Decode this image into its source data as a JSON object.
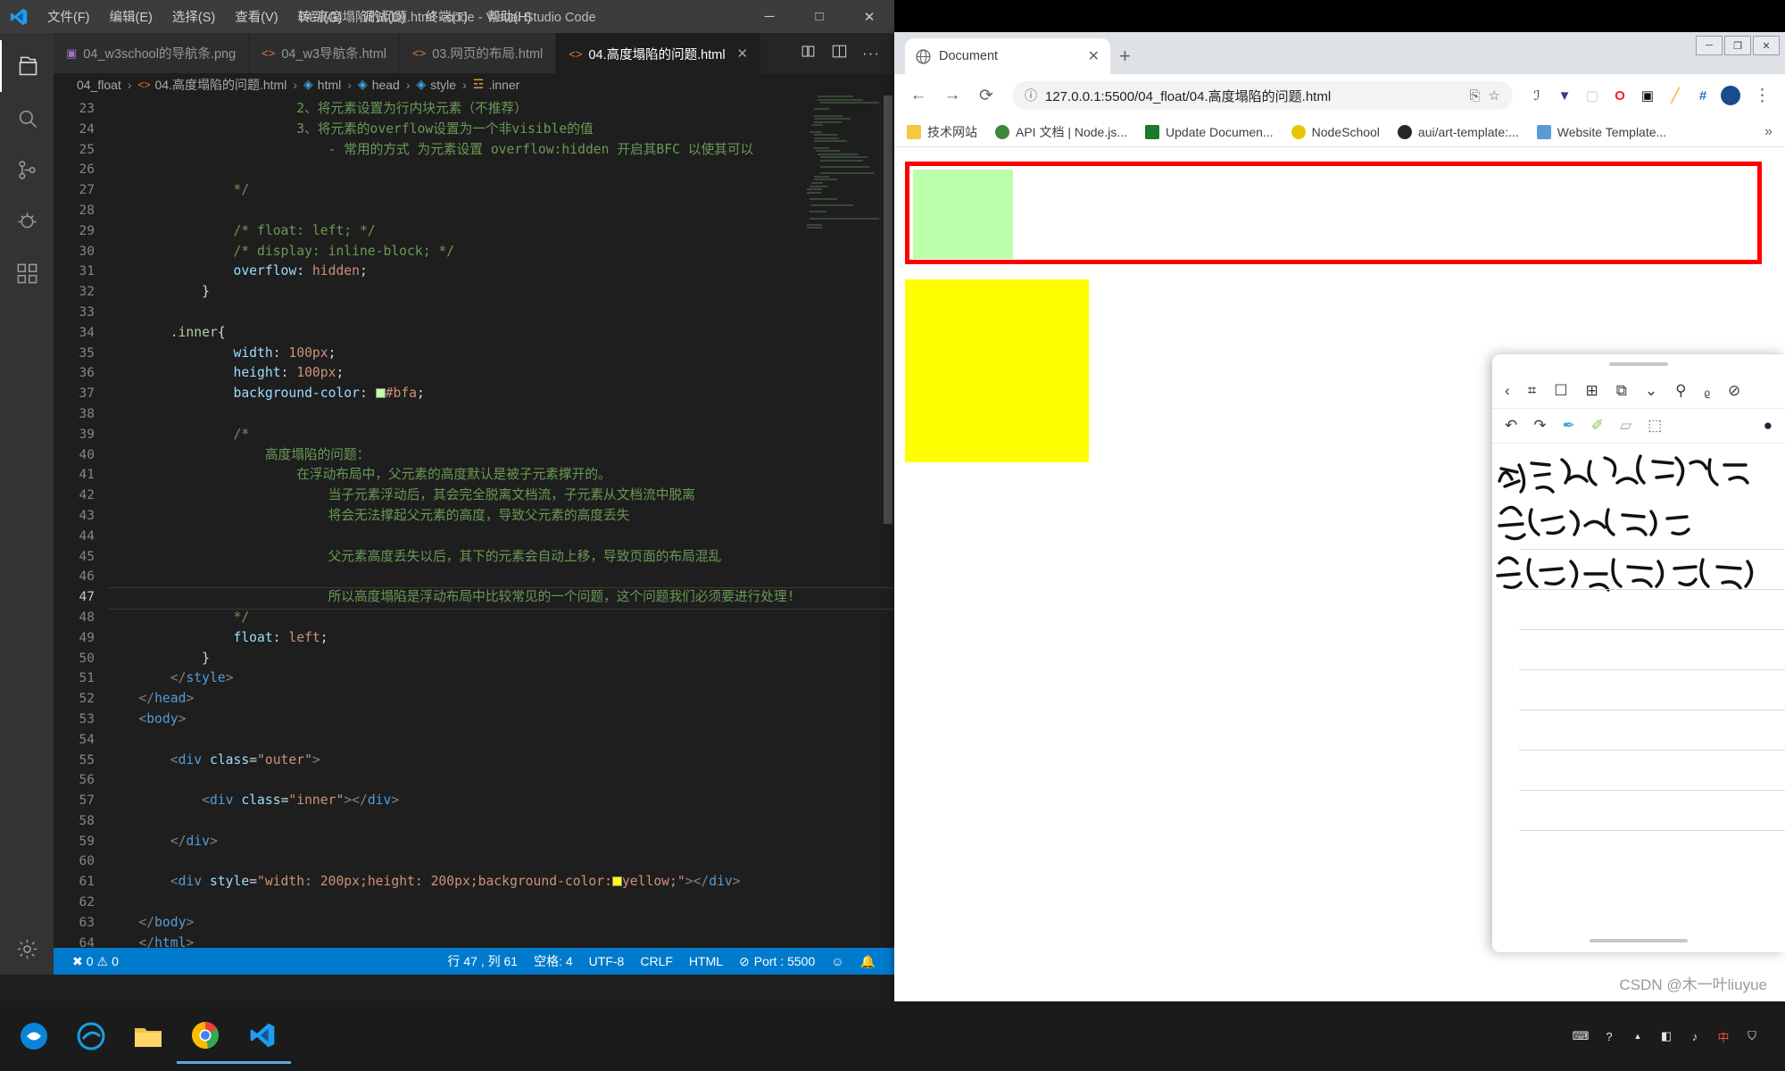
{
  "vscode": {
    "window_title": "04.高度塌陷的问题.html - code - Visual Studio Code",
    "logo_icon": "vscode-logo-icon",
    "menu": [
      {
        "label": "文件(F)",
        "name": "menu-file"
      },
      {
        "label": "编辑(E)",
        "name": "menu-edit"
      },
      {
        "label": "选择(S)",
        "name": "menu-selection"
      },
      {
        "label": "查看(V)",
        "name": "menu-view"
      },
      {
        "label": "转到(G)",
        "name": "menu-go"
      },
      {
        "label": "调试(D)",
        "name": "menu-debug"
      },
      {
        "label": "终端(T)",
        "name": "menu-terminal"
      },
      {
        "label": "帮助(H)",
        "name": "menu-help"
      }
    ],
    "window_buttons": {
      "minimize": "─",
      "maximize": "□",
      "close": "✕"
    },
    "activity_bar": [
      {
        "name": "explorer-icon",
        "label": "Explorer"
      },
      {
        "name": "search-icon",
        "label": "Search"
      },
      {
        "name": "source-control-icon",
        "label": "Source Control"
      },
      {
        "name": "debug-icon",
        "label": "Run and Debug"
      },
      {
        "name": "extensions-icon",
        "label": "Extensions"
      },
      {
        "name": "settings-gear-icon",
        "label": "Manage"
      }
    ],
    "tabs": [
      {
        "label": "04_w3school的导航条.png",
        "icon": "image-file-icon",
        "active": false
      },
      {
        "label": "04_w3导航条.html",
        "icon": "html-file-icon",
        "active": false
      },
      {
        "label": "03.网页的布局.html",
        "icon": "html-file-icon",
        "active": false
      },
      {
        "label": "04.高度塌陷的问题.html",
        "icon": "html-file-icon",
        "active": true,
        "close": "✕"
      }
    ],
    "tab_actions": [
      {
        "name": "split-editor-icon"
      },
      {
        "name": "open-changes-icon"
      },
      {
        "name": "more-actions-icon",
        "label": "···"
      }
    ],
    "breadcrumb": [
      {
        "label": "04_float",
        "icon": "folder-icon"
      },
      {
        "label": "04.高度塌陷的问题.html",
        "icon": "html-file-icon"
      },
      {
        "label": "html",
        "icon": "symbol-cube-icon"
      },
      {
        "label": "head",
        "icon": "symbol-cube-icon"
      },
      {
        "label": "style",
        "icon": "symbol-cube-icon"
      },
      {
        "label": ".inner",
        "icon": "symbol-ruler-icon"
      }
    ],
    "breadcrumb_separator": "›",
    "first_line_number": 23,
    "current_line": 47,
    "code_lines": [
      {
        "n": 23,
        "html": "                        <span class=\"cm\">2、将元素设置为行内块元素（不推荐）</span>"
      },
      {
        "n": 24,
        "html": "                        <span class=\"cm\">3、将元素的overflow设置为一个非visible的值</span>"
      },
      {
        "n": 25,
        "html": "                            <span class=\"cm\">- 常用的方式 为元素设置 overflow:hidden 开启其BFC 以使其可以</span>"
      },
      {
        "n": 26,
        "html": ""
      },
      {
        "n": 27,
        "html": "                <span class=\"cm\">*/</span>"
      },
      {
        "n": 28,
        "html": ""
      },
      {
        "n": 29,
        "html": "                <span class=\"cm\">/* float: left; */</span>"
      },
      {
        "n": 30,
        "html": "                <span class=\"cm\">/* display: inline-block; */</span>"
      },
      {
        "n": 31,
        "html": "                <span class=\"prop\">overflow</span><span class=\"pl\">: </span><span class=\"val\">hidden</span><span class=\"pl\">;</span>"
      },
      {
        "n": 32,
        "html": "            <span class=\"pl\">}</span>"
      },
      {
        "n": 33,
        "html": ""
      },
      {
        "n": 34,
        "html": "        <span class=\"num\">.inner</span><span class=\"pl\">{</span>"
      },
      {
        "n": 35,
        "html": "                <span class=\"prop\">width</span><span class=\"pl\">: </span><span class=\"val\">100px</span><span class=\"pl\">;</span>"
      },
      {
        "n": 36,
        "html": "                <span class=\"prop\">height</span><span class=\"pl\">: </span><span class=\"val\">100px</span><span class=\"pl\">;</span>"
      },
      {
        "n": 37,
        "html": "                <span class=\"prop\">background-color</span><span class=\"pl\">: </span><span class=\"swatch\" style=\"background:#bbffaa\"></span><span class=\"val\">#bfa</span><span class=\"pl\">;</span>"
      },
      {
        "n": 38,
        "html": ""
      },
      {
        "n": 39,
        "html": "                <span class=\"cm\">/*</span>"
      },
      {
        "n": 40,
        "html": "                    <span class=\"cm\">高度塌陷的问题：</span>"
      },
      {
        "n": 41,
        "html": "                        <span class=\"cm\">在浮动布局中，父元素的高度默认是被子元素撑开的。</span>"
      },
      {
        "n": 42,
        "html": "                            <span class=\"cm\">当子元素浮动后，其会完全脱离文档流，子元素从文档流中脱离</span>"
      },
      {
        "n": 43,
        "html": "                            <span class=\"cm\">将会无法撑起父元素的高度，导致父元素的高度丢失</span>"
      },
      {
        "n": 44,
        "html": ""
      },
      {
        "n": 45,
        "html": "                            <span class=\"cm\">父元素高度丢失以后，其下的元素会自动上移，导致页面的布局混乱</span>"
      },
      {
        "n": 46,
        "html": ""
      },
      {
        "n": 47,
        "html": "                            <span class=\"cm\">所以高度塌陷是浮动布局中比较常见的一个问题，这个问题我们必须要进行处理!</span>"
      },
      {
        "n": 48,
        "html": "                <span class=\"cm\">*/</span>"
      },
      {
        "n": 49,
        "html": "                <span class=\"prop\">float</span><span class=\"pl\">: </span><span class=\"val\">left</span><span class=\"pl\">;</span>"
      },
      {
        "n": 50,
        "html": "            <span class=\"pl\">}</span>"
      },
      {
        "n": 51,
        "html": "        <span class=\"punc\">&lt;/</span><span class=\"tag\">style</span><span class=\"punc\">&gt;</span>"
      },
      {
        "n": 52,
        "html": "    <span class=\"punc\">&lt;/</span><span class=\"tag\">head</span><span class=\"punc\">&gt;</span>"
      },
      {
        "n": 53,
        "html": "    <span class=\"punc\">&lt;</span><span class=\"tag\">body</span><span class=\"punc\">&gt;</span>"
      },
      {
        "n": 54,
        "html": ""
      },
      {
        "n": 55,
        "html": "        <span class=\"punc\">&lt;</span><span class=\"tag\">div</span> <span class=\"attr\">class</span><span class=\"pl\">=</span><span class=\"str\">\"outer\"</span><span class=\"punc\">&gt;</span>"
      },
      {
        "n": 56,
        "html": ""
      },
      {
        "n": 57,
        "html": "            <span class=\"punc\">&lt;</span><span class=\"tag\">div</span> <span class=\"attr\">class</span><span class=\"pl\">=</span><span class=\"str\">\"inner\"</span><span class=\"punc\">&gt;&lt;/</span><span class=\"tag\">div</span><span class=\"punc\">&gt;</span>"
      },
      {
        "n": 58,
        "html": ""
      },
      {
        "n": 59,
        "html": "        <span class=\"punc\">&lt;/</span><span class=\"tag\">div</span><span class=\"punc\">&gt;</span>"
      },
      {
        "n": 60,
        "html": ""
      },
      {
        "n": 61,
        "html": "        <span class=\"punc\">&lt;</span><span class=\"tag\">div</span> <span class=\"attr\">style</span><span class=\"pl\">=</span><span class=\"str\">\"width: 200px;height: 200px;background-color:</span><span class=\"swatch\" style=\"background:#ffff00\"></span><span class=\"str\">yellow;\"</span><span class=\"punc\">&gt;&lt;/</span><span class=\"tag\">div</span><span class=\"punc\">&gt;</span>"
      },
      {
        "n": 62,
        "html": ""
      },
      {
        "n": 63,
        "html": "    <span class=\"punc\">&lt;/</span><span class=\"tag\">body</span><span class=\"punc\">&gt;</span>"
      },
      {
        "n": 64,
        "html": "    <span class=\"punc\">&lt;/</span><span class=\"tag\">html</span><span class=\"punc\">&gt;</span>"
      }
    ],
    "status_bar": {
      "errors": "0",
      "warnings": "0",
      "error_icon": "error-circle-icon",
      "warning_icon": "warning-triangle-icon",
      "cursor_position": "行 47 , 列 61",
      "indentation": "空格: 4",
      "encoding": "UTF-8",
      "eol": "CRLF",
      "language": "HTML",
      "live_server": "Port : 5500",
      "live_server_icon": "broadcast-icon",
      "feedback_icon": "smiley-icon",
      "bell_icon": "bell-icon"
    }
  },
  "browser": {
    "tab": {
      "title": "Document",
      "favicon": "globe-icon",
      "close": "✕"
    },
    "new_tab": "+",
    "window_buttons": {
      "minimize": "─",
      "maximize": "❐",
      "close": "✕"
    },
    "nav": {
      "back": "←",
      "forward": "→",
      "reload": "⟳"
    },
    "omnibox": {
      "info_icon": "info-circle-icon",
      "url": "127.0.0.1:5500/04_float/04.高度塌陷的问题.html",
      "translate_icon": "translate-icon",
      "bookmark_star_icon": "star-icon"
    },
    "extensions": [
      {
        "name": "ext-measure-icon",
        "glyph": "ℐ",
        "color": "#2a3f6b"
      },
      {
        "name": "ext-filter-icon",
        "glyph": "▼",
        "color": "#3a3a8c"
      },
      {
        "name": "ext-blank-icon",
        "glyph": "▢",
        "color": "#cccccc"
      },
      {
        "name": "ext-opera-icon",
        "glyph": "O",
        "color": "#ff1b2d"
      },
      {
        "name": "ext-device-icon",
        "glyph": "▣",
        "color": "#111111"
      },
      {
        "name": "ext-pencil-icon",
        "glyph": "╱",
        "color": "#f2c14e"
      },
      {
        "name": "ext-grid-icon",
        "glyph": "#",
        "color": "#2f6fd0"
      }
    ],
    "avatar_name": "profile-avatar",
    "menu_glyph": "⋮",
    "bookmarks": [
      {
        "label": "技术网站",
        "icon_color": "#f5c842",
        "name": "bookmark-folder-tech"
      },
      {
        "label": "API 文档 | Node.js...",
        "icon_color": "#3c873a",
        "name": "bookmark-nodejs-docs"
      },
      {
        "label": "Update Documen...",
        "icon_color": "#1a7a2e",
        "name": "bookmark-update-doc"
      },
      {
        "label": "NodeSchool",
        "icon_color": "#e8c600",
        "name": "bookmark-nodeschool"
      },
      {
        "label": "aui/art-template:...",
        "icon_color": "#24292e",
        "name": "bookmark-art-template"
      },
      {
        "label": "Website Template...",
        "icon_color": "#5b9bd5",
        "name": "bookmark-website-template"
      }
    ],
    "bookmarks_overflow": "»",
    "page": {
      "outer_border_color": "#ff0000",
      "inner_box_color": "#bbffaa",
      "yellow_box_color": "#ffff00"
    }
  },
  "ink_panel": {
    "toolbar_top": [
      {
        "name": "back-chevron-icon",
        "glyph": "‹"
      },
      {
        "name": "grid-view-icon",
        "glyph": "⌗"
      },
      {
        "name": "bookmark-icon",
        "glyph": "☐"
      },
      {
        "name": "add-page-icon",
        "glyph": "⊞"
      },
      {
        "name": "copy-page-icon",
        "glyph": "⧉"
      },
      {
        "name": "chevron-down-icon",
        "glyph": "⌄"
      },
      {
        "name": "search-icon",
        "glyph": "⚲"
      },
      {
        "name": "microphone-icon",
        "glyph": "ᵨ"
      },
      {
        "name": "hide-icon",
        "glyph": "⊘"
      }
    ],
    "toolbar_tools": [
      {
        "name": "undo-icon",
        "glyph": "↶"
      },
      {
        "name": "redo-icon",
        "glyph": "↷"
      },
      {
        "name": "pen-tool-icon",
        "glyph": "✒",
        "color": "#3aa7d9"
      },
      {
        "name": "highlighter-tool-icon",
        "glyph": "✐",
        "color": "#8bc34a"
      },
      {
        "name": "eraser-tool-icon",
        "glyph": "▱",
        "color": "#9e9e9e"
      },
      {
        "name": "select-tool-icon",
        "glyph": "⬚",
        "color": "#666666"
      },
      {
        "name": "color-swatch-icon",
        "glyph": "●",
        "color": "#1b2a3a"
      }
    ],
    "handwriting_note": "handwritten-chinese-notes"
  },
  "taskbar": {
    "items": [
      {
        "name": "taskbar-start-icon",
        "label": "Start",
        "color": "#0a84d8",
        "running": false
      },
      {
        "name": "taskbar-edge-icon",
        "label": "Microsoft Edge",
        "color": "#1b9de2",
        "running": false
      },
      {
        "name": "taskbar-explorer-icon",
        "label": "File Explorer",
        "color": "#f0c040",
        "running": false
      },
      {
        "name": "taskbar-chrome-icon",
        "label": "Google Chrome",
        "color": "#4285f4",
        "running": true
      },
      {
        "name": "taskbar-vscode-icon",
        "label": "Visual Studio Code",
        "color": "#2a7ab8",
        "running": true
      }
    ],
    "tray": [
      {
        "name": "tray-keyboard-icon",
        "glyph": "⌨"
      },
      {
        "name": "tray-help-icon",
        "glyph": "?"
      },
      {
        "name": "tray-chevron-up-icon",
        "glyph": "▲"
      },
      {
        "name": "tray-network-icon",
        "glyph": "◧"
      },
      {
        "name": "tray-volume-icon",
        "glyph": "♪"
      },
      {
        "name": "tray-ime-icon",
        "glyph": "中"
      },
      {
        "name": "tray-shield-icon",
        "glyph": "⛉"
      }
    ]
  },
  "watermark": "CSDN @木一叶liuyue"
}
